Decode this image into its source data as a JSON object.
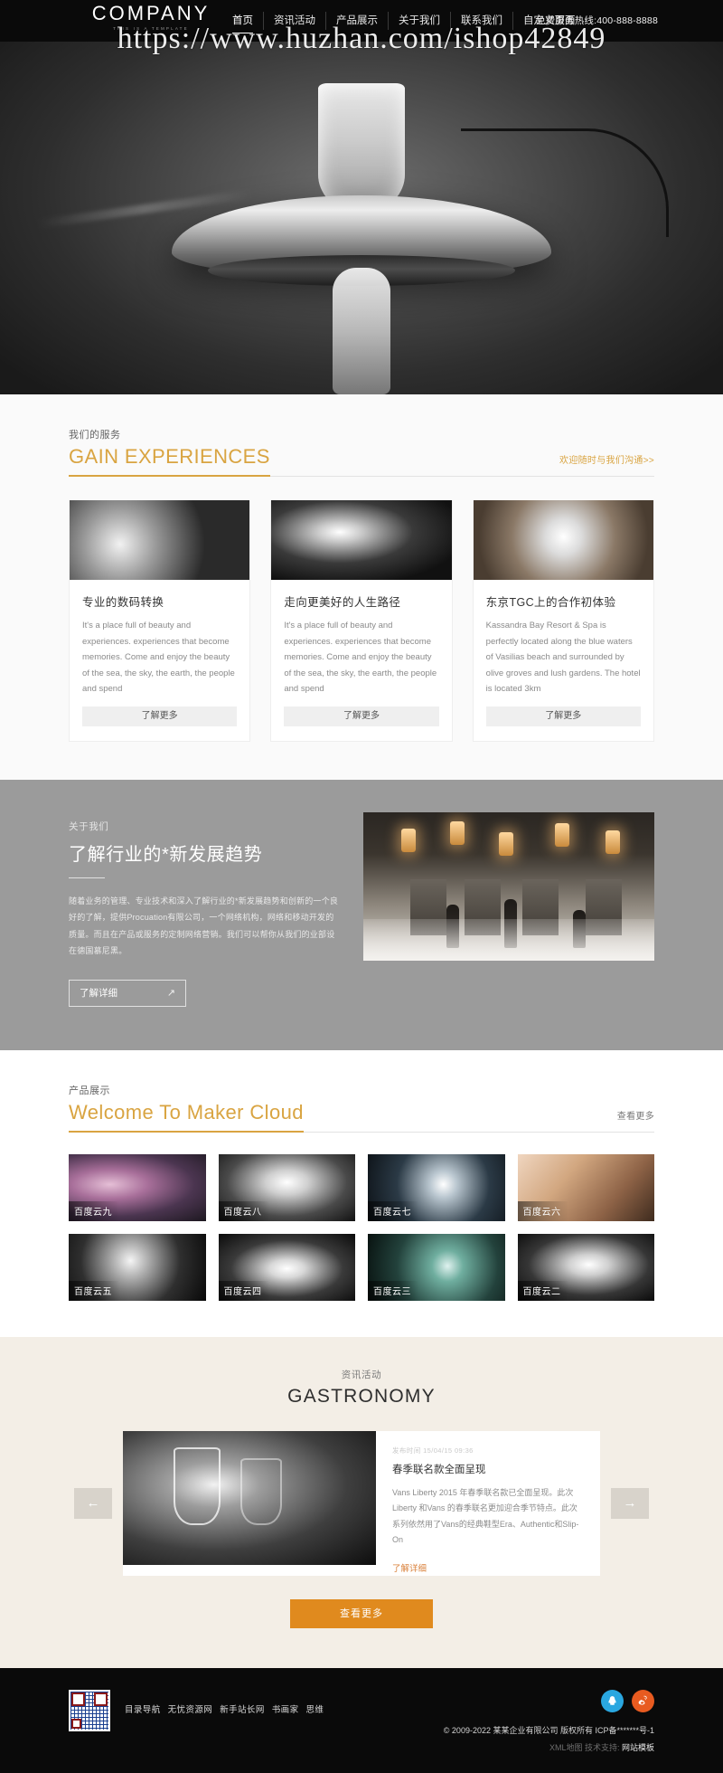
{
  "header": {
    "logo_main": "COMPANY",
    "logo_sub": "THIS IS A TEMPLATE",
    "nav": [
      {
        "label": "首页",
        "active": true
      },
      {
        "label": "资讯活动",
        "active": false
      },
      {
        "label": "产品展示",
        "active": false
      },
      {
        "label": "关于我们",
        "active": false
      },
      {
        "label": "联系我们",
        "active": false
      },
      {
        "label": "自定义页面",
        "active": false
      }
    ],
    "hotline": "免费服务热线:400-888-8888",
    "watermark": "https://www.huzhan.com/ishop42849"
  },
  "services": {
    "zh_title": "我们的服务",
    "en_title": "GAIN EXPERIENCES",
    "more_link": "欢迎随时与我们沟通>>",
    "cards": [
      {
        "title": "专业的数码转换",
        "body": "It's a place full of beauty and experiences. experiences that become memories. Come and enjoy the beauty of the sea, the sky, the earth, the people and spend",
        "button": "了解更多"
      },
      {
        "title": "走向更美好的人生路径",
        "body": "It's a place full of beauty and experiences. experiences that become memories. Come and enjoy the beauty of the sea, the sky, the earth, the people and spend",
        "button": "了解更多"
      },
      {
        "title": "东京TGC上的合作初体验",
        "body": "Kassandra Bay Resort & Spa is perfectly located along the blue waters of Vasilias beach and surrounded by olive groves and lush gardens. The hotel is located 3km",
        "button": "了解更多"
      }
    ]
  },
  "about": {
    "zh_label": "关于我们",
    "heading": "了解行业的*新发展趋势",
    "paragraph": "随着业务的管理、专业技术和深入了解行业的*新发展趋势和创新的一个良好的了解，提供Procuation有限公司，一个网络机构，网络和移动开发的质量。而且在产品或服务的定制网络营销。我们可以帮你从我们的业部设在德国慕尼黑。",
    "button": "了解详细",
    "button_arrow": "↗"
  },
  "products": {
    "zh_title": "产品展示",
    "en_title": "Welcome To Maker Cloud",
    "more_link": "查看更多",
    "items": [
      {
        "label": "百度云九"
      },
      {
        "label": "百度云八"
      },
      {
        "label": "百度云七"
      },
      {
        "label": "百度云六"
      },
      {
        "label": "百度云五"
      },
      {
        "label": "百度云四"
      },
      {
        "label": "百度云三"
      },
      {
        "label": "百度云二"
      }
    ]
  },
  "news": {
    "zh_title": "资讯活动",
    "en_title": "GASTRONOMY",
    "prev_arrow": "←",
    "next_arrow": "→",
    "item": {
      "date": "发布时间 15/04/15 09:36",
      "title": "春季联名款全面呈现",
      "body": "Vans Liberty 2015 年春季联名款已全面呈现。此次 Liberty 和Vans 的春季联名更加迎合季节特点。此次系列依然用了Vans的经典鞋型Era、Authentic和Slip-On",
      "link": "了解详细"
    },
    "more_button": "查看更多"
  },
  "footer": {
    "friend_links": [
      "目录导航",
      "无忧资源网",
      "新手站长网",
      "书画家",
      "思维"
    ],
    "social": [
      {
        "name": "qq",
        "glyph": "🐧"
      },
      {
        "name": "weibo",
        "glyph": "@"
      }
    ],
    "copyright": "© 2009-2022 某某企业有限公司 版权所有   ICP备*******号-1",
    "sitemap": "XML地图 技术支持:",
    "support": "网站模板"
  },
  "colors": {
    "accent_gold": "#d9a441",
    "accent_orange": "#e08a1e",
    "dark": "#0a0a0a",
    "about_bg": "#9b9b9b",
    "news_bg": "#f3eee6"
  }
}
